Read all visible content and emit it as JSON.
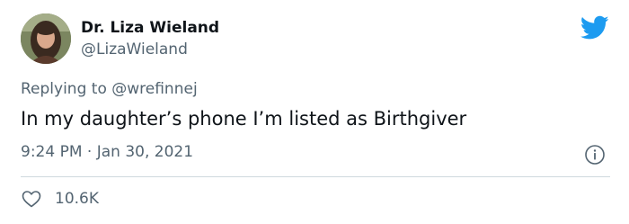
{
  "author": {
    "display_name": "Dr. Liza Wieland",
    "handle": "@LizaWieland",
    "avatar_icon": "profile-photo"
  },
  "reply": {
    "prefix": "Replying to",
    "mention": "@wrefinnej"
  },
  "tweet": {
    "text": "In my daughter’s phone I’m listed as Birthgiver",
    "time": "9:24 PM",
    "separator": "·",
    "date": "Jan 30, 2021"
  },
  "engagement": {
    "likes": "10.6K"
  },
  "colors": {
    "brand_blue": "#1d9bf0",
    "secondary_text": "#536471",
    "primary_text": "#0f1419",
    "divider": "#cfd9de"
  },
  "icons": {
    "logo": "twitter-bird-icon",
    "info": "info-icon",
    "like": "heart-icon"
  }
}
